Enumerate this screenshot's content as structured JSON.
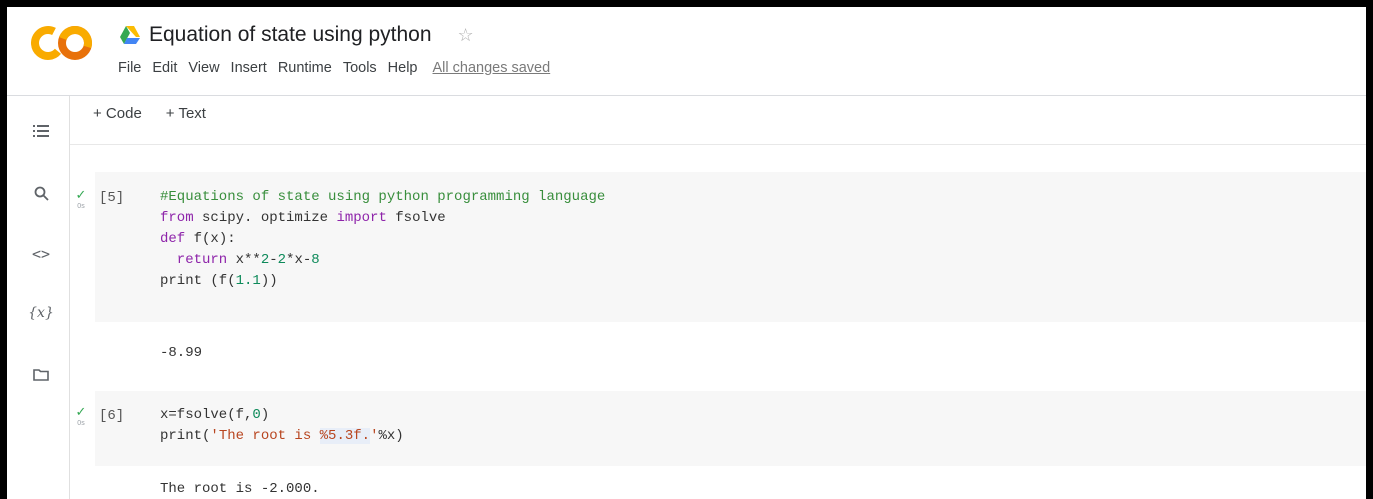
{
  "header": {
    "title": "Equation of state using python",
    "menu": [
      "File",
      "Edit",
      "View",
      "Insert",
      "Runtime",
      "Tools",
      "Help"
    ],
    "save_status": "All changes saved"
  },
  "toolbar": {
    "code_label": "+ Code",
    "text_label": "+ Text"
  },
  "rail": {
    "icons": [
      "table-of-contents-icon",
      "search-icon",
      "code-snippets-icon",
      "variables-icon",
      "files-icon"
    ],
    "variables_label": "{x}"
  },
  "cells": [
    {
      "exec_count": "[5]",
      "exec_time": "0s",
      "lines": {
        "l1": "#Equations of state using python programming language",
        "l2_a": "from",
        "l2_b": " scipy. optimize ",
        "l2_c": "import",
        "l2_d": " fsolve",
        "l3_a": "def",
        "l3_b": " f(x):",
        "l4_a": "  return",
        "l4_b": " x**",
        "l4_c": "2",
        "l4_d": "-",
        "l4_e": "2",
        "l4_f": "*x-",
        "l4_g": "8",
        "l5_a": "print (f(",
        "l5_b": "1.1",
        "l5_c": "))"
      },
      "output": "-8.99"
    },
    {
      "exec_count": "[6]",
      "exec_time": "0s",
      "lines": {
        "l1_a": "x=fsolve(f,",
        "l1_b": "0",
        "l1_c": ")",
        "l2_a": "print(",
        "l2_b": "'The root is ",
        "l2_c": "%5.3f.",
        "l2_d": "'",
        "l2_e": "%x)"
      },
      "output": "The root is -2.000."
    }
  ],
  "colors": {
    "check": "#34a853",
    "comment": "#388e3c",
    "keyword": "#8e24aa",
    "number": "#0d8a5a",
    "string": "#b8451f",
    "logo_orange": "#f9ab00",
    "logo_yellow": "#e8710a"
  }
}
